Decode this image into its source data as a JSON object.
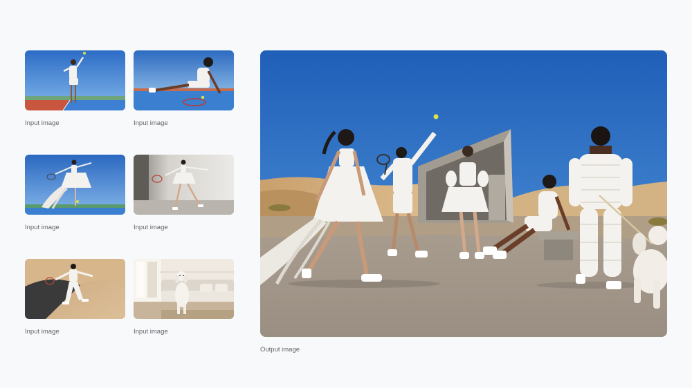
{
  "inputs": [
    {
      "caption": "Input image",
      "subject": "tennis-player-serving"
    },
    {
      "caption": "Input image",
      "subject": "person-sitting-on-court"
    },
    {
      "caption": "Input image",
      "subject": "player-in-ribbon-dress"
    },
    {
      "caption": "Input image",
      "subject": "player-in-studio"
    },
    {
      "caption": "Input image",
      "subject": "person-on-sand-dune"
    },
    {
      "caption": "Input image",
      "subject": "poodle-in-living-room"
    }
  ],
  "output": {
    "caption": "Output image",
    "subject": "composite-desert-tennis-scene"
  },
  "colors": {
    "sky": "#2f6fc4",
    "sand": "#d9b98c",
    "court_blue": "#3a7fd0",
    "court_red": "#c95a44",
    "outfit": "#f4f2ee"
  }
}
